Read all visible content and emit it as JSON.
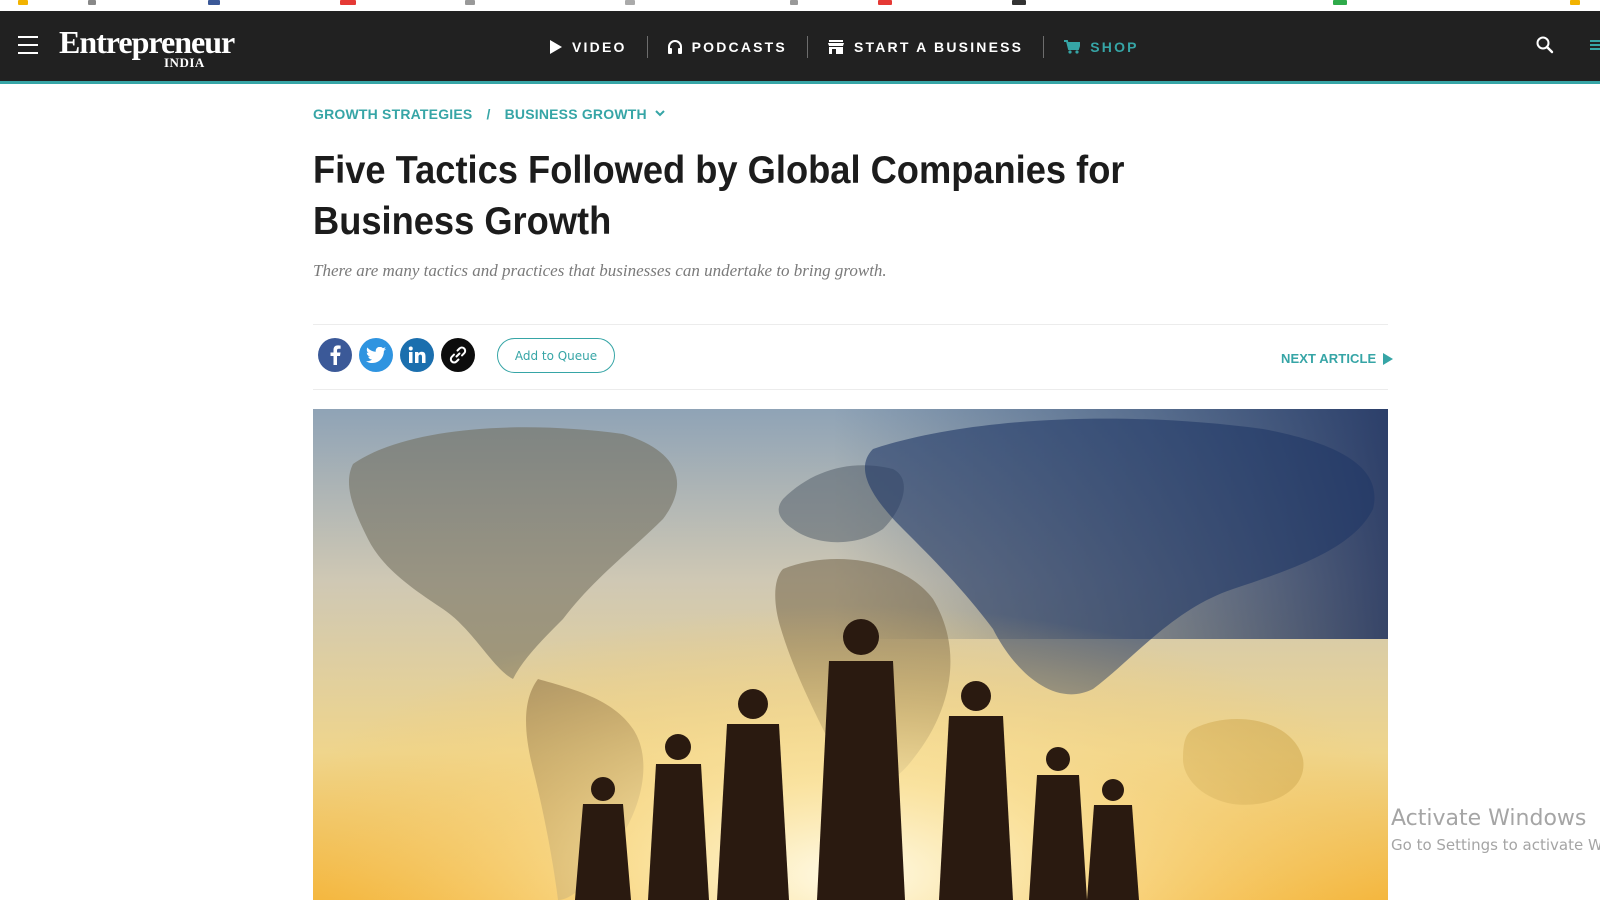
{
  "brand": {
    "name": "Entrepreneur",
    "edition": "INDIA"
  },
  "nav": {
    "items": [
      {
        "label": "VIDEO",
        "icon": "play-icon"
      },
      {
        "label": "PODCASTS",
        "icon": "headphones-icon"
      },
      {
        "label": "START A BUSINESS",
        "icon": "store-icon"
      },
      {
        "label": "SHOP",
        "icon": "cart-icon"
      }
    ],
    "accent": "#36a5a6",
    "background": "#212121"
  },
  "breadcrumb": {
    "items": [
      "GROWTH STRATEGIES",
      "BUSINESS GROWTH"
    ],
    "separator": "/"
  },
  "article": {
    "title": "Five Tactics Followed by Global Companies for Business Growth",
    "dek": "There are many tactics and practices that businesses can undertake to bring growth."
  },
  "share": {
    "icons": [
      "facebook-icon",
      "twitter-icon",
      "linkedin-icon",
      "link-icon"
    ],
    "queue_label": "Add to Queue",
    "next_label": "NEXT ARTICLE"
  },
  "hero": {
    "description_icon": "world-map-silhouettes-image"
  },
  "watermark": {
    "line1": "Activate Windows",
    "line2": "Go to Settings to activate Windows."
  }
}
